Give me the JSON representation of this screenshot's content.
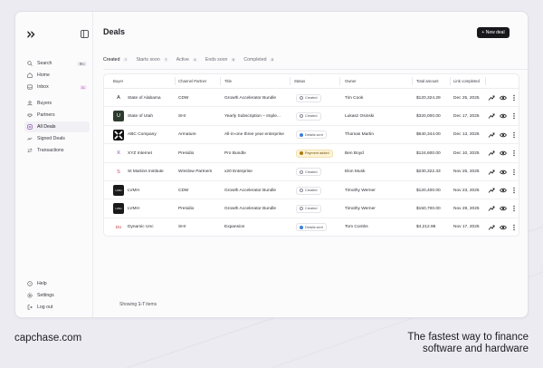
{
  "sidebar": {
    "search": {
      "label": "Search",
      "shortcut": "⌘K"
    },
    "items": [
      {
        "label": "Home"
      },
      {
        "label": "Inbox",
        "count": "31"
      },
      {
        "label": "Buyers"
      },
      {
        "label": "Partners"
      },
      {
        "label": "All Deals"
      },
      {
        "label": "Signed Deals"
      },
      {
        "label": "Transactions"
      }
    ],
    "bottom": [
      {
        "label": "Help"
      },
      {
        "label": "Settings"
      },
      {
        "label": "Log out"
      }
    ]
  },
  "page": {
    "title": "Deals",
    "new_deal_label": "+ New deal",
    "footer": {
      "prefix": "Showing ",
      "count": "1-7",
      "suffix": " items"
    }
  },
  "tabs": [
    {
      "label": "Created",
      "count": "7",
      "active": true
    },
    {
      "label": "Starts soon",
      "count": "7"
    },
    {
      "label": "Active",
      "count": "4"
    },
    {
      "label": "Ends soon",
      "count": "8"
    },
    {
      "label": "Completed",
      "count": "8"
    }
  ],
  "table": {
    "headers": [
      "Buyer",
      "Channel Partner",
      "Title",
      "Status",
      "Owner",
      "Total amount",
      "Link completed"
    ],
    "rows": [
      {
        "logo": "A",
        "logo_style": "text",
        "buyer": "State of Alabama",
        "partner": "CDW",
        "title": "Growth Accelerator Bundle",
        "status": "Created",
        "owner": "Tim Cook",
        "amount": "$120,324.29",
        "date": "Dec 25, 2025"
      },
      {
        "logo": "U",
        "logo_style": "dark",
        "buyer": "State of Utah",
        "partner": "SHI",
        "title": "Yearly Subscription – Imple...",
        "status": "Created",
        "owner": "Lukasz Osinski",
        "amount": "$320,000.00",
        "date": "Dec 17, 2025"
      },
      {
        "logo": "",
        "logo_style": "abc",
        "buyer": "ABC Company",
        "partner": "Armature",
        "title": "All-in-one three year enterprise",
        "status": "Details sent",
        "owner": "Thomas Martin",
        "amount": "$640,344.00",
        "date": "Dec 13, 2025"
      },
      {
        "logo": "X",
        "logo_style": "text-purple",
        "buyer": "XYZ Internet",
        "partner": "Presidio",
        "title": "Pro Bundle",
        "status": "Payment added",
        "owner": "Ben Boyd",
        "amount": "$124,600.00",
        "date": "Dec 10, 2025"
      },
      {
        "logo": "S",
        "logo_style": "text-pink",
        "buyer": "St Martins Institute",
        "partner": "Winslow Partners",
        "title": "x20 Enterprise",
        "status": "Created",
        "owner": "Elon Musk",
        "amount": "$230,322.33",
        "date": "Nov 25, 2025"
      },
      {
        "logo": "LVMH",
        "logo_style": "lvmh",
        "buyer": "LVMH",
        "partner": "CDW",
        "title": "Growth Accelerator Bundle",
        "status": "Created",
        "owner": "Timothy Werner",
        "amount": "$120,400.00",
        "date": "Nov 23, 2025"
      },
      {
        "logo": "LVMH",
        "logo_style": "lvmh",
        "buyer": "LVMH",
        "partner": "Presidio",
        "title": "Growth Accelerator Bundle",
        "status": "Created",
        "owner": "Timothy Werner",
        "amount": "$150,700.00",
        "date": "Nov 29, 2025"
      },
      {
        "logo": "DU",
        "logo_style": "text-red",
        "buyer": "Dynamic Unc",
        "partner": "SHI",
        "title": "Expansion",
        "status": "Details sent",
        "owner": "Tom Combs",
        "amount": "$4,212.98",
        "date": "Nov 17, 2025"
      }
    ]
  },
  "branding": {
    "domain": "capchase.com",
    "tagline_line1": "The fastest way to finance",
    "tagline_line2": "software and hardware"
  },
  "colors": {
    "accent_dark": "#17171c",
    "created": "#8e8e98",
    "details_sent": "#3b7fe0",
    "payment_added_bg": "#fdf3d6",
    "payment_added_fg": "#a97a10",
    "inbox_count": "#a14bb0"
  }
}
